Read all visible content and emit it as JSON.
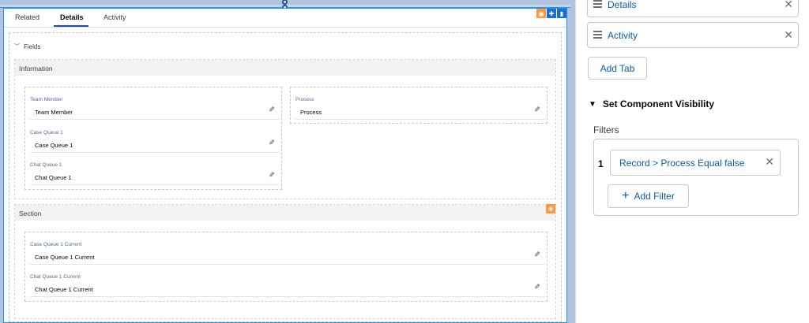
{
  "builder": {
    "tabs": [
      {
        "label": "Related"
      },
      {
        "label": "Details"
      },
      {
        "label": "Activity"
      }
    ],
    "active_tab": "Details",
    "fields_header": "Fields",
    "sections": [
      {
        "title": "Information",
        "groups": [
          {
            "fields": [
              {
                "label": "Team Member",
                "value": "Team Member"
              },
              {
                "label": "Case Queue 1",
                "value": "Case Queue 1"
              },
              {
                "label": "Chat Queue 1",
                "value": "Chat Queue 1"
              }
            ]
          },
          {
            "fields": [
              {
                "label": "Process",
                "value": "Process"
              }
            ]
          }
        ]
      },
      {
        "title": "Section",
        "groups": [
          {
            "fields": [
              {
                "label": "Case Queue 1 Current",
                "value": "Case Queue 1 Current"
              },
              {
                "label": "Chat Queue 1 Current",
                "value": "Chat Queue 1 Current"
              }
            ]
          }
        ]
      }
    ]
  },
  "panel": {
    "tab_rows": [
      {
        "label": "Details"
      },
      {
        "label": "Activity"
      }
    ],
    "add_tab_label": "Add Tab",
    "visibility_heading": "Set Component Visibility",
    "filters_label": "Filters",
    "filters": [
      {
        "index": "1",
        "label": "Record > Process Equal false"
      }
    ],
    "add_filter_label": "Add Filter"
  },
  "colors": {
    "canvas_bg": "#b0c4df",
    "selection_blue": "#1b96ff",
    "link_blue": "#0b5cab",
    "visibility_orange": "#ff9a3c",
    "section_bar": "#f3f2f2"
  },
  "icons": {
    "tab_toolbar": [
      "eye-icon",
      "move-icon",
      "delete-icon"
    ],
    "field_edit": "pencil-icon",
    "tab_row": [
      "drag-handle-icon",
      "close-icon"
    ],
    "add_filter": "plus-icon"
  }
}
